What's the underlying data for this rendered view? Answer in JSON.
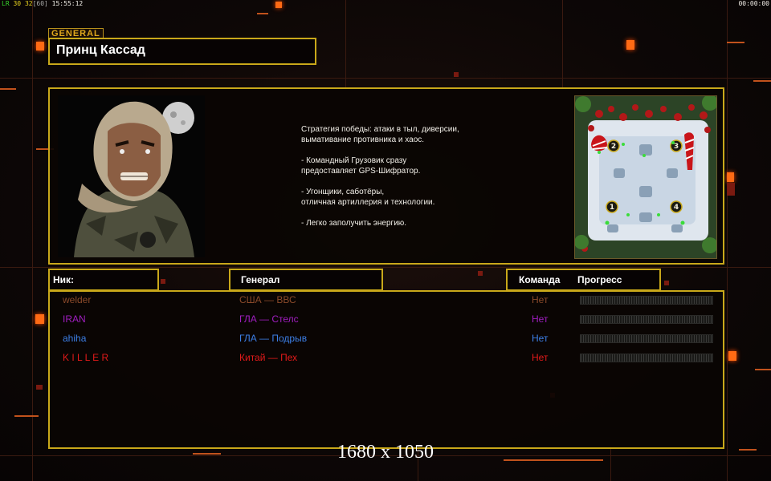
{
  "topbar": {
    "fps_prefix": "LR",
    "fps_a": "30",
    "fps_b": "32",
    "fps_c": "[60]",
    "clock": "15:55:12",
    "timer": "00:00:00"
  },
  "general": {
    "tag": "GENERAL",
    "name": "Принц Кассад"
  },
  "description": {
    "lines": [
      "Стратегия победы: атаки в тыл, диверсии,\n вымативание противника и хаос.",
      "- Командный Грузовик сразу\nпредоставляет GPS-Шифратор.",
      "- Угонщики, саботёры,\nотличная артиллерия и технологии.",
      "- Легко заполучить энергию."
    ]
  },
  "minimap": {
    "slots": [
      "1",
      "2",
      "3",
      "4"
    ]
  },
  "headers": {
    "nick": "Ник:",
    "general": "Генерал",
    "team": "Команда",
    "progress": "Прогресс"
  },
  "players": [
    {
      "nick": "welder",
      "general": "США — ВВС",
      "team": "Нет",
      "color": "#8b4a2a",
      "progress": 0
    },
    {
      "nick": "IRAN",
      "general": "ГЛА — Стелс",
      "team": "Нет",
      "color": "#a11ec0",
      "progress": 0
    },
    {
      "nick": "ahiha",
      "general": "ГЛА — Подрыв",
      "team": "Нет",
      "color": "#3c7fe6",
      "progress": 0
    },
    {
      "nick": "K I L L E R",
      "general": "Китай — Пех",
      "team": "Нет",
      "color": "#e21a1a",
      "progress": 0
    }
  ],
  "overlay": {
    "resolution": "1680 x 1050"
  },
  "colors": {
    "frame": "#c9a81a",
    "accent": "#ff6a14"
  }
}
